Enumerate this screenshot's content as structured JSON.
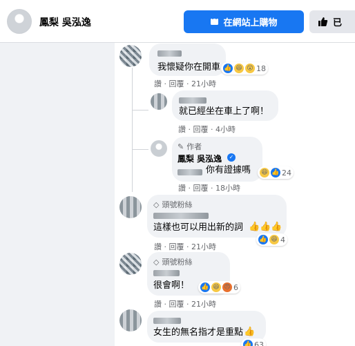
{
  "header": {
    "page_name": "鳳梨 吳泓逸",
    "shop_button": "在網站上購物",
    "like_button_label": "已"
  },
  "comments": [
    {
      "text": "我懷疑你在開車",
      "reaction_count": "18",
      "actions": [
        "讚",
        "回覆",
        "21小時"
      ]
    },
    {
      "text": "就已經坐在車上了啊！",
      "actions": [
        "讚",
        "回覆",
        "4小時"
      ]
    },
    {
      "author_badge": "作者",
      "author": "鳳梨 吳泓逸",
      "text": "你有證據嗎",
      "reaction_count": "24",
      "actions": [
        "讚",
        "回覆",
        "18小時"
      ]
    },
    {
      "badge": "頭號粉絲",
      "text": "這樣也可以用出新的詞",
      "reaction_count": "4",
      "actions": [
        "讚",
        "回覆",
        "21小時"
      ]
    },
    {
      "badge": "頭號粉絲",
      "text": "很會啊！",
      "reaction_count": "6",
      "actions": [
        "讚",
        "回覆",
        "21小時"
      ]
    },
    {
      "text": "女生的無名指才是重點",
      "reaction_count": "63"
    }
  ],
  "icons": {
    "shop": "shopping-bag-icon",
    "like": "thumbs-up-icon",
    "verified": "verified-check-icon",
    "pencil": "author-pencil-icon",
    "diamond": "top-fan-diamond-icon"
  }
}
